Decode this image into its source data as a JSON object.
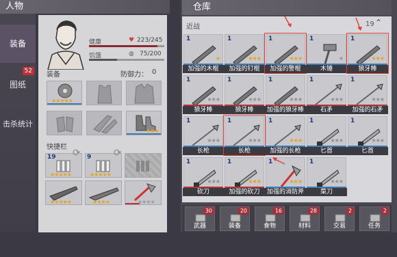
{
  "left_tabs": [
    {
      "label": "装备",
      "active": true
    },
    {
      "label": "图纸",
      "badge": "52"
    },
    {
      "label": "击杀统计"
    }
  ],
  "character": {
    "title": "人物",
    "health_label": "健康",
    "health_value": "223/245",
    "health_fraction": 0.91,
    "hunger_label": "饥饿",
    "hunger_value": "75/200",
    "hunger_fraction": 0.375,
    "equip_label": "装备",
    "defense_label": "防御力：",
    "defense_value": "0",
    "quickbar_label": "快捷栏",
    "equip_slots": [
      {
        "icon": "saw-blade-icon",
        "stars": 5,
        "filled": true
      },
      {
        "icon": "tanktop-icon",
        "stars": 0
      },
      {
        "icon": "jacket-icon",
        "stars": 0
      },
      {
        "icon": "gloves-icon",
        "stars": 0
      },
      {
        "icon": "pants-icon",
        "stars": 0
      },
      {
        "icon": "boots-icon",
        "stars": 3,
        "filled": true
      }
    ],
    "quick_slots": [
      {
        "qty": "19",
        "icon": "ammo-icon",
        "stars": 5
      },
      {
        "qty": "9",
        "icon": "ammo-icon",
        "stars": 5
      },
      {
        "qty": "",
        "icon": "ammo-empty-icon",
        "stars": 0
      },
      {
        "qty": "",
        "icon": "rifle-icon",
        "stars": 5
      },
      {
        "qty": "",
        "icon": "shotgun-icon",
        "stars": 4
      },
      {
        "qty": "",
        "icon": "fire-axe-icon",
        "stars": 4,
        "grey": true
      }
    ]
  },
  "warehouse": {
    "title": "仓库",
    "category_label": "近战",
    "category_count": "19",
    "items": [
      {
        "qty": "1",
        "name": "加强的木棍",
        "stars": "★",
        "under": "#3a7bb8"
      },
      {
        "qty": "1",
        "name": "加强的钉棍",
        "stars": "★★★",
        "under": "#3a7bb8"
      },
      {
        "qty": "1",
        "name": "加强的警棍",
        "stars": "★★★",
        "under": "#3a7bb8",
        "highlight": true
      },
      {
        "qty": "1",
        "name": "木锤",
        "stars": "★",
        "grey": true,
        "under": "#3a7bb8"
      },
      {
        "qty": "1",
        "name": "狼牙棒",
        "stars": "★★★",
        "under": "#3a7bb8",
        "highlight": true
      },
      {
        "qty": "1",
        "name": "狼牙棒",
        "stars": "★★★",
        "grey": true,
        "under": "#b3343a"
      },
      {
        "qty": "1",
        "name": "狼牙棒",
        "stars": "★★★",
        "grey": true,
        "under": "#b3343a"
      },
      {
        "qty": "1",
        "name": "加强的狼牙棒",
        "stars": "★★★",
        "grey": true,
        "under": "#b3343a"
      },
      {
        "qty": "1",
        "name": "石矛",
        "stars": "★★★",
        "grey": true,
        "under": "#b3343a"
      },
      {
        "qty": "1",
        "name": "加强的石矛",
        "stars": "★★★",
        "grey": true,
        "under": "#b3343a"
      },
      {
        "qty": "1",
        "name": "长枪",
        "stars": "★★★",
        "grey": true,
        "under": "#3a7bb8"
      },
      {
        "qty": "1",
        "name": "长枪",
        "stars": "★★★",
        "grey": true,
        "under": "#3a7bb8",
        "highlight": true
      },
      {
        "qty": "1",
        "name": "加强的长枪",
        "stars": "★★★",
        "under": "#3a7bb8"
      },
      {
        "qty": "1",
        "name": "匕首",
        "stars": "★★★",
        "grey": true,
        "under": "#3a7bb8"
      },
      {
        "qty": "1",
        "name": "匕首",
        "stars": "★★★",
        "grey": true,
        "under": "#3a7bb8"
      },
      {
        "qty": "1",
        "name": "砍刀",
        "stars": "★★★",
        "grey": true,
        "under": "#b3343a"
      },
      {
        "qty": "1",
        "name": "加强的砍刀",
        "stars": "★★★",
        "under": "#b3343a"
      },
      {
        "qty": "1",
        "name": "加强的消防斧",
        "stars": "★★★",
        "under": "#3a7bb8"
      },
      {
        "qty": "1",
        "name": "菜刀",
        "stars": "★★★",
        "grey": true,
        "under": "#3a7bb8"
      }
    ],
    "categories": [
      {
        "label": "武器",
        "count": "30"
      },
      {
        "label": "装备",
        "count": "20"
      },
      {
        "label": "食物",
        "count": "16"
      },
      {
        "label": "材料",
        "count": "28"
      },
      {
        "label": "交易",
        "count": "2"
      },
      {
        "label": "任务",
        "count": "2"
      }
    ]
  },
  "colors": {
    "highlight": "#e0403c",
    "star": "#e6a21c",
    "badge": "#b9323a"
  }
}
